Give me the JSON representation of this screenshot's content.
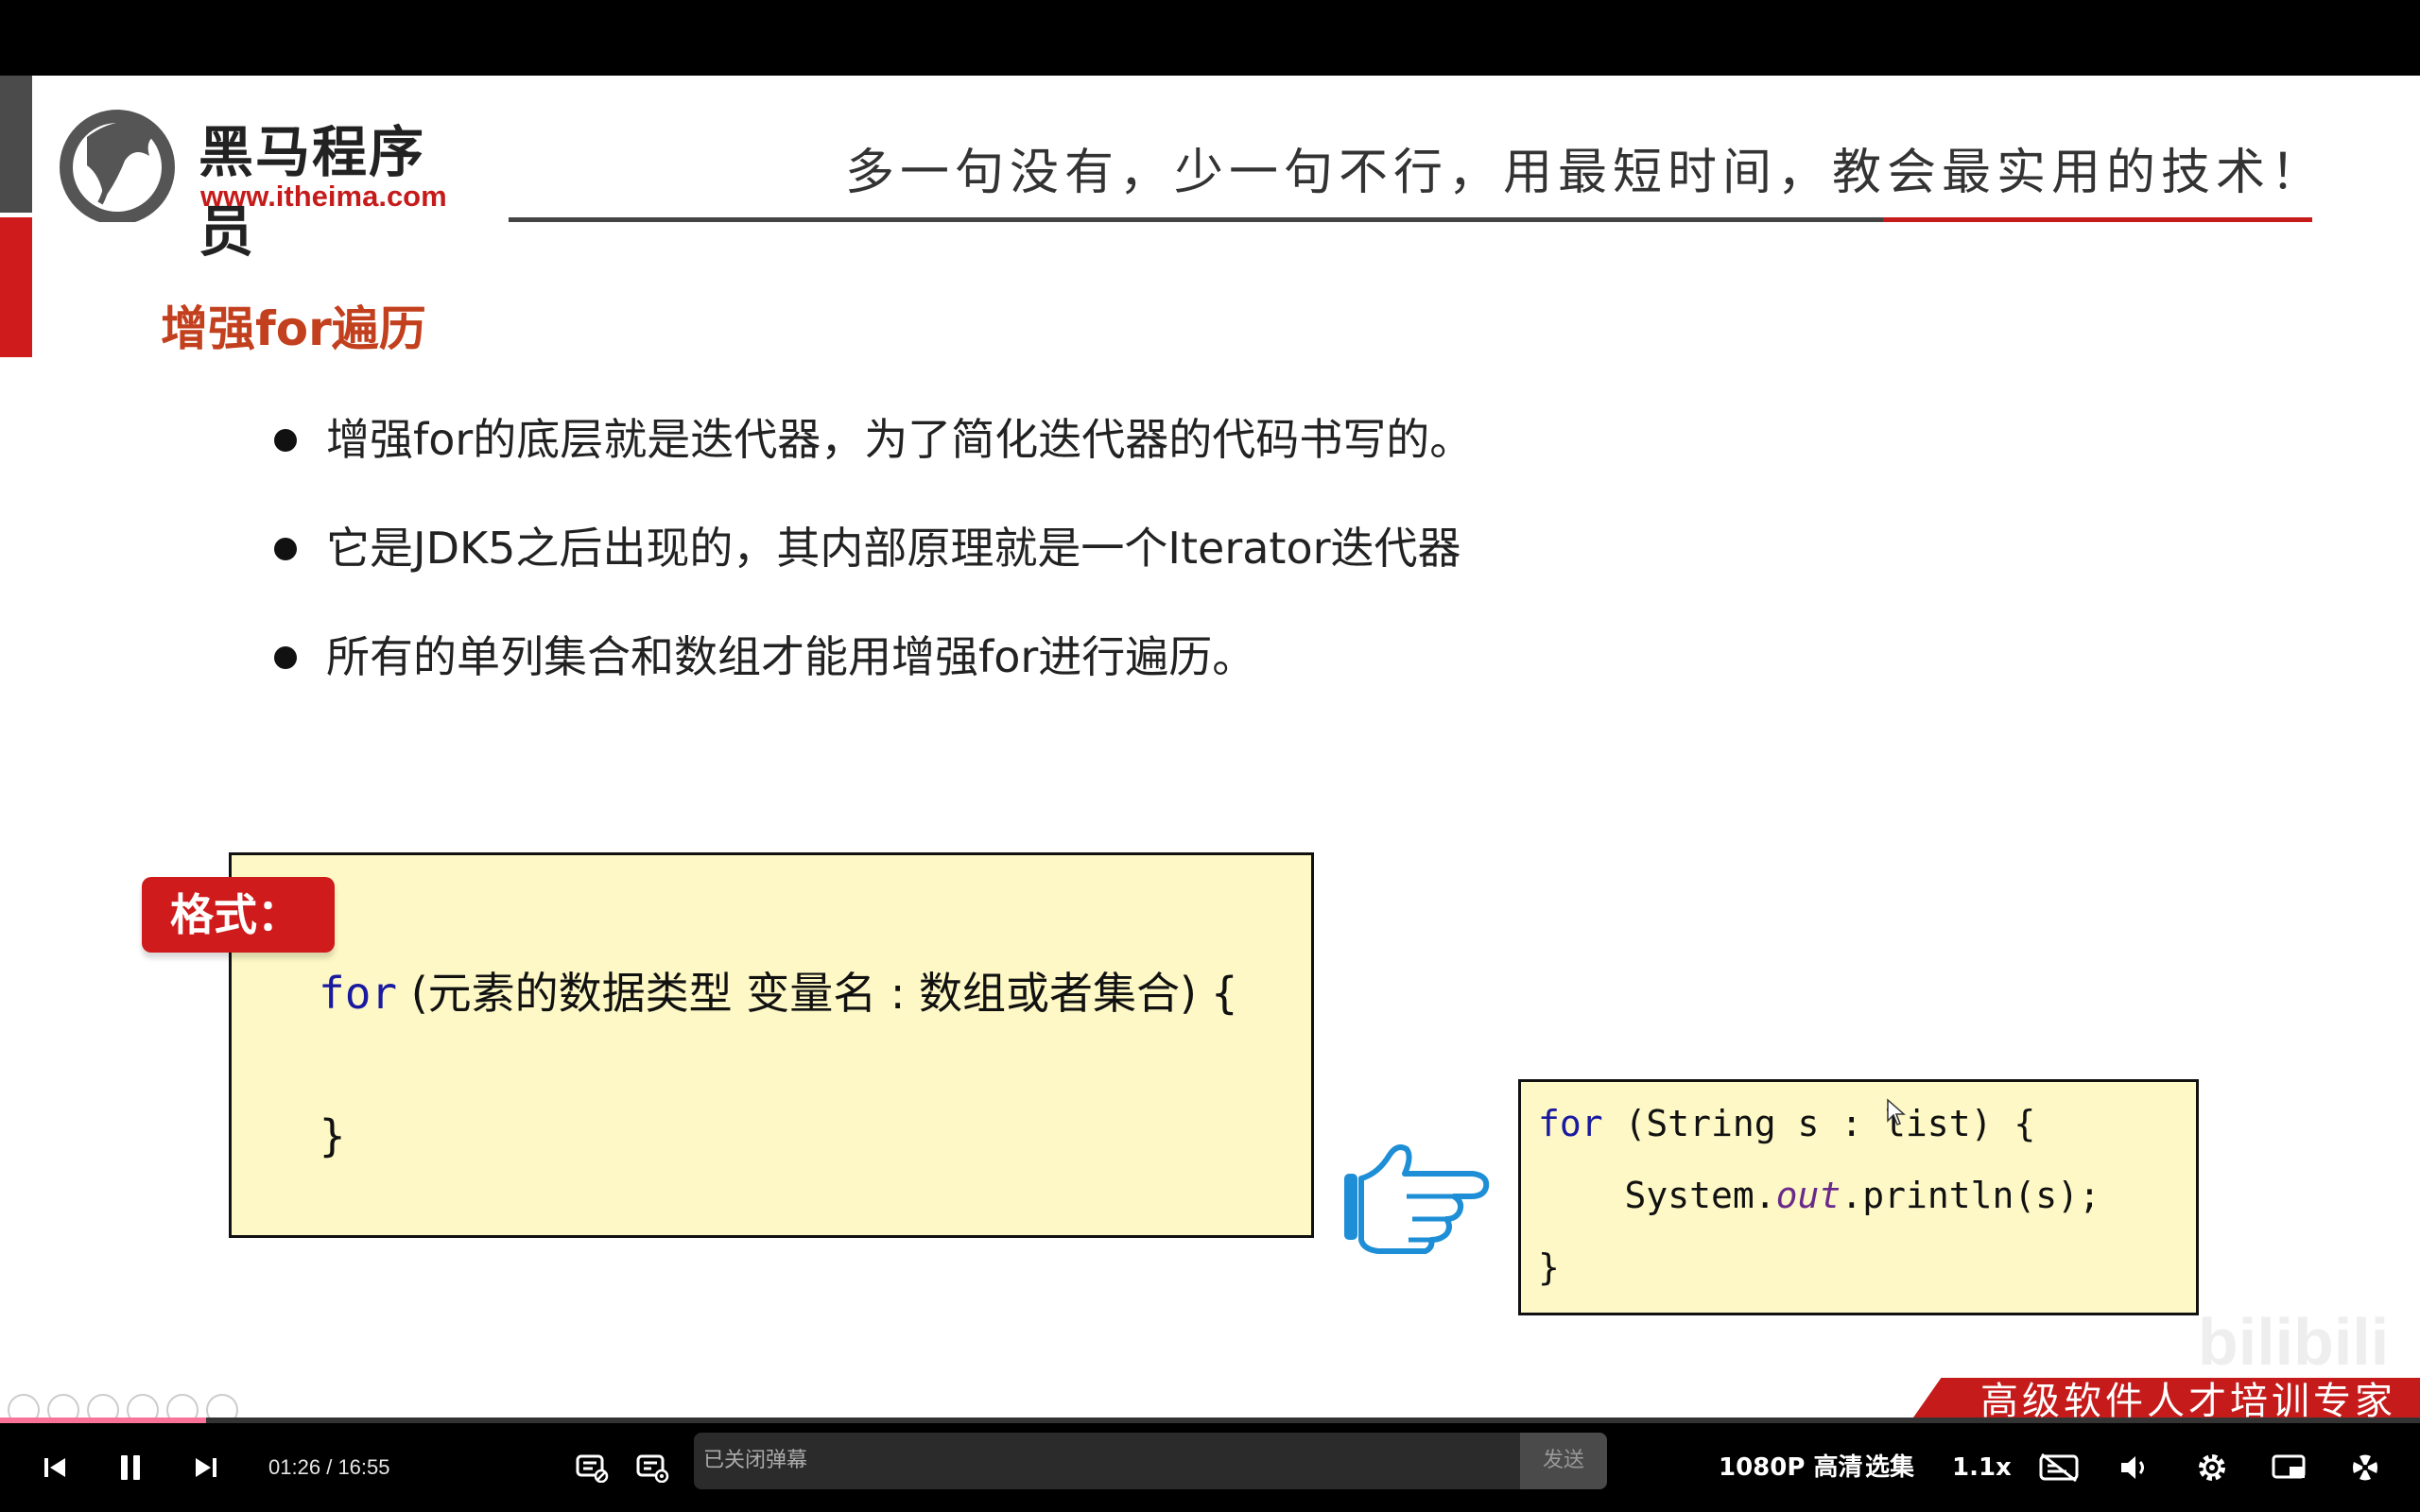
{
  "logo": {
    "name_cn": "黑马程序员",
    "url": "www.itheima.com"
  },
  "slide": {
    "slogan": "多一句没有，少一句不行，用最短时间，教会最实用的技术！",
    "section_title": "增强for遍历",
    "bullets": [
      "增强for的底层就是迭代器，为了简化迭代器的代码书写的。",
      "它是JDK5之后出现的，其内部原理就是一个Iterator迭代器",
      "所有的单列集合和数组才能用增强for进行遍历。"
    ],
    "format_badge": "格式：",
    "format_keyword": "for",
    "format_rest": " (元素的数据类型 变量名 : 数组或者集合) {",
    "format_close": "}",
    "example": {
      "kw": "for",
      "line1_rest": " (String s : list) {",
      "line2_a": "    System.",
      "line2_italic": "out",
      "line2_b": ".println(s);",
      "line3": "}"
    },
    "footer_slogan": "高级软件人才培训专家",
    "watermark": "bilibili"
  },
  "player": {
    "current_time": "01:26",
    "separator": "/",
    "duration": "16:55",
    "progress": 0.085,
    "danmaku_placeholder": "已关闭弹幕",
    "send_label": "发送",
    "quality": "1080P 高清",
    "episodes": "选集",
    "speed": "1.1x",
    "accent": "#fb7299"
  }
}
